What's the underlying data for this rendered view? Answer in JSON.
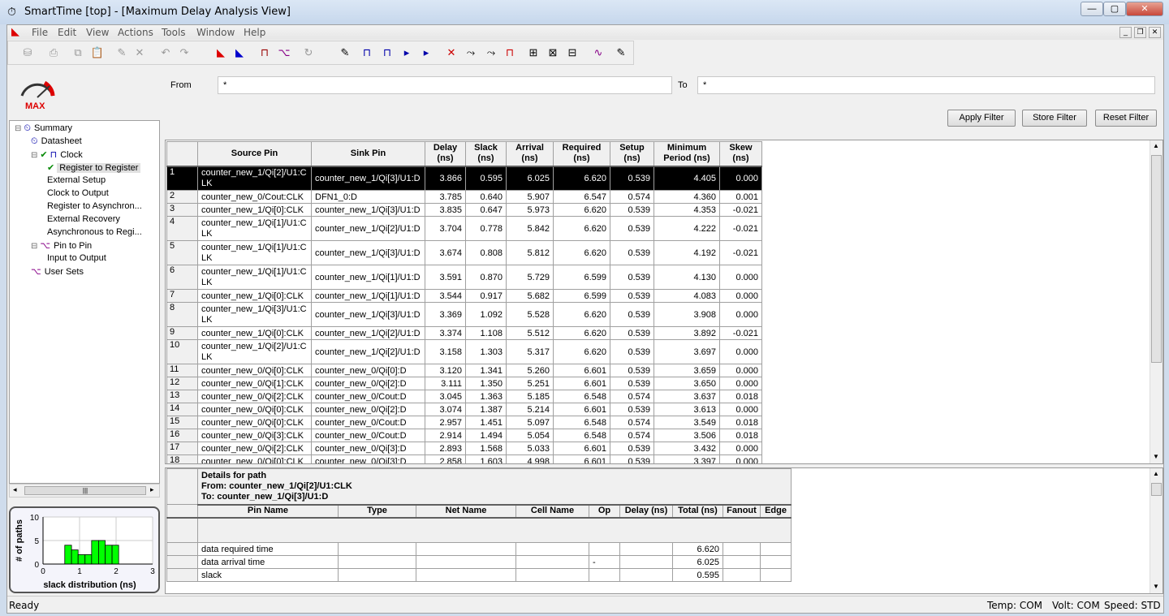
{
  "window": {
    "title": "SmartTime [top] - [Maximum Delay Analysis View]",
    "minimize": "—",
    "maximize": "▢",
    "close": "✕"
  },
  "menu": [
    "File",
    "Edit",
    "View",
    "Actions",
    "Tools",
    "Window",
    "Help"
  ],
  "logo": {
    "text": "MAX"
  },
  "tree": [
    {
      "label": "Summary",
      "level": 0,
      "icon": "summary-clock-icon",
      "expander": "⊟"
    },
    {
      "label": "Datasheet",
      "level": 1,
      "icon": "datasheet-clock-icon"
    },
    {
      "label": "Clock",
      "level": 1,
      "icon": "clock-waveform-icon",
      "expander": "⊟",
      "check": true
    },
    {
      "label": "Register to Register",
      "level": 2,
      "check": true,
      "selected": true
    },
    {
      "label": "External Setup",
      "level": 2
    },
    {
      "label": "Clock to Output",
      "level": 2
    },
    {
      "label": "Register to Asynchron...",
      "level": 2
    },
    {
      "label": "External Recovery",
      "level": 2
    },
    {
      "label": "Asynchronous to Regi...",
      "level": 2
    },
    {
      "label": "Pin to Pin",
      "level": 1,
      "icon": "pin-to-pin-icon",
      "expander": "⊟"
    },
    {
      "label": "Input to Output",
      "level": 2
    },
    {
      "label": "User Sets",
      "level": 1,
      "icon": "pin-to-pin-icon"
    }
  ],
  "filter": {
    "from_label": "From",
    "from_value": "*",
    "to_label": "To",
    "to_value": "*",
    "apply": "Apply Filter",
    "store": "Store Filter",
    "reset": "Reset Filter"
  },
  "table": {
    "headers": [
      "",
      "Source Pin",
      "Sink Pin",
      "Delay (ns)",
      "Slack (ns)",
      "Arrival (ns)",
      "Required (ns)",
      "Setup (ns)",
      "Minimum Period (ns)",
      "Skew (ns)"
    ],
    "rows": [
      [
        "1",
        "counter_new_1/Qi[2]/U1:CLK",
        "counter_new_1/Qi[3]/U1:D",
        "3.866",
        "0.595",
        "6.025",
        "6.620",
        "0.539",
        "4.405",
        "0.000"
      ],
      [
        "2",
        "counter_new_0/Cout:CLK",
        "DFN1_0:D",
        "3.785",
        "0.640",
        "5.907",
        "6.547",
        "0.574",
        "4.360",
        "0.001"
      ],
      [
        "3",
        "counter_new_1/Qi[0]:CLK",
        "counter_new_1/Qi[3]/U1:D",
        "3.835",
        "0.647",
        "5.973",
        "6.620",
        "0.539",
        "4.353",
        "-0.021"
      ],
      [
        "4",
        "counter_new_1/Qi[1]/U1:CLK",
        "counter_new_1/Qi[2]/U1:D",
        "3.704",
        "0.778",
        "5.842",
        "6.620",
        "0.539",
        "4.222",
        "-0.021"
      ],
      [
        "5",
        "counter_new_1/Qi[1]/U1:CLK",
        "counter_new_1/Qi[3]/U1:D",
        "3.674",
        "0.808",
        "5.812",
        "6.620",
        "0.539",
        "4.192",
        "-0.021"
      ],
      [
        "6",
        "counter_new_1/Qi[1]/U1:CLK",
        "counter_new_1/Qi[1]/U1:D",
        "3.591",
        "0.870",
        "5.729",
        "6.599",
        "0.539",
        "4.130",
        "0.000"
      ],
      [
        "7",
        "counter_new_1/Qi[0]:CLK",
        "counter_new_1/Qi[1]/U1:D",
        "3.544",
        "0.917",
        "5.682",
        "6.599",
        "0.539",
        "4.083",
        "0.000"
      ],
      [
        "8",
        "counter_new_1/Qi[3]/U1:CLK",
        "counter_new_1/Qi[3]/U1:D",
        "3.369",
        "1.092",
        "5.528",
        "6.620",
        "0.539",
        "3.908",
        "0.000"
      ],
      [
        "9",
        "counter_new_1/Qi[0]:CLK",
        "counter_new_1/Qi[2]/U1:D",
        "3.374",
        "1.108",
        "5.512",
        "6.620",
        "0.539",
        "3.892",
        "-0.021"
      ],
      [
        "10",
        "counter_new_1/Qi[2]/U1:CLK",
        "counter_new_1/Qi[2]/U1:D",
        "3.158",
        "1.303",
        "5.317",
        "6.620",
        "0.539",
        "3.697",
        "0.000"
      ],
      [
        "11",
        "counter_new_0/Qi[0]:CLK",
        "counter_new_0/Qi[0]:D",
        "3.120",
        "1.341",
        "5.260",
        "6.601",
        "0.539",
        "3.659",
        "0.000"
      ],
      [
        "12",
        "counter_new_0/Qi[1]:CLK",
        "counter_new_0/Qi[2]:D",
        "3.111",
        "1.350",
        "5.251",
        "6.601",
        "0.539",
        "3.650",
        "0.000"
      ],
      [
        "13",
        "counter_new_0/Qi[2]:CLK",
        "counter_new_0/Cout:D",
        "3.045",
        "1.363",
        "5.185",
        "6.548",
        "0.574",
        "3.637",
        "0.018"
      ],
      [
        "14",
        "counter_new_0/Qi[0]:CLK",
        "counter_new_0/Qi[2]:D",
        "3.074",
        "1.387",
        "5.214",
        "6.601",
        "0.539",
        "3.613",
        "0.000"
      ],
      [
        "15",
        "counter_new_0/Qi[0]:CLK",
        "counter_new_0/Cout:D",
        "2.957",
        "1.451",
        "5.097",
        "6.548",
        "0.574",
        "3.549",
        "0.018"
      ],
      [
        "16",
        "counter_new_0/Qi[3]:CLK",
        "counter_new_0/Cout:D",
        "2.914",
        "1.494",
        "5.054",
        "6.548",
        "0.574",
        "3.506",
        "0.018"
      ],
      [
        "17",
        "counter_new_0/Qi[2]:CLK",
        "counter_new_0/Qi[3]:D",
        "2.893",
        "1.568",
        "5.033",
        "6.601",
        "0.539",
        "3.432",
        "0.000"
      ],
      [
        "18",
        "counter_new_0/Qi[0]:CLK",
        "counter_new_0/Qi[3]:D",
        "2.858",
        "1.603",
        "4.998",
        "6.601",
        "0.539",
        "3.397",
        "0.000"
      ]
    ]
  },
  "details": {
    "title": "Details for path",
    "from": "From: counter_new_1/Qi[2]/U1:CLK",
    "to": "To: counter_new_1/Qi[3]/U1:D",
    "headers": [
      "",
      "Pin Name",
      "Type",
      "Net Name",
      "Cell Name",
      "Op",
      "Delay (ns)",
      "Total (ns)",
      "Fanout",
      "Edge"
    ],
    "rows": [
      [
        "",
        "data required time",
        "",
        "",
        "",
        "",
        "",
        "6.620",
        "",
        ""
      ],
      [
        "",
        "data arrival time",
        "",
        "",
        "",
        "-",
        "",
        "6.025",
        "",
        ""
      ],
      [
        "",
        "slack",
        "",
        "",
        "",
        "",
        "",
        "0.595",
        "",
        ""
      ]
    ]
  },
  "chart_data": {
    "type": "bar",
    "xlabel": "slack distribution (ns)",
    "ylabel": "# of paths",
    "xlim": [
      0,
      3
    ],
    "ylim": [
      0,
      10
    ],
    "xticks": [
      "0",
      "1",
      "2",
      "3"
    ],
    "yticks": [
      "0",
      "5",
      "10"
    ],
    "grid": true,
    "bar_color": "#00ff00",
    "bins": [
      [
        0.595,
        0.78
      ],
      [
        0.78,
        0.96
      ],
      [
        0.96,
        1.15
      ],
      [
        1.15,
        1.33
      ],
      [
        1.33,
        1.52
      ],
      [
        1.52,
        1.7
      ],
      [
        1.7,
        1.89
      ],
      [
        1.89,
        2.07
      ]
    ],
    "values": [
      4,
      3,
      2,
      2,
      5,
      5,
      4,
      4
    ]
  },
  "status": {
    "left": "Ready",
    "temp": "Temp: COM",
    "volt": "Volt: COM",
    "speed": "Speed: STD"
  }
}
